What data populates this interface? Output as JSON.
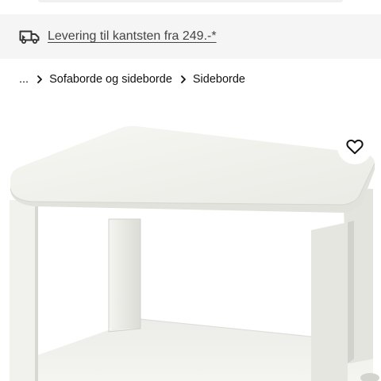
{
  "delivery": {
    "label": "Levering til kantsten fra 249.-*",
    "icon": "truck-icon"
  },
  "breadcrumb": {
    "items": [
      "...",
      "Sofaborde og sideborde",
      "Sideborde"
    ],
    "separator_icon": "chevron-right-icon"
  },
  "product": {
    "favourite_icon": "heart-icon",
    "image_icon": "side-table-image"
  },
  "colors": {
    "banner_background": "#f5f5f5",
    "text": "#111111",
    "link_text": "#444444"
  }
}
